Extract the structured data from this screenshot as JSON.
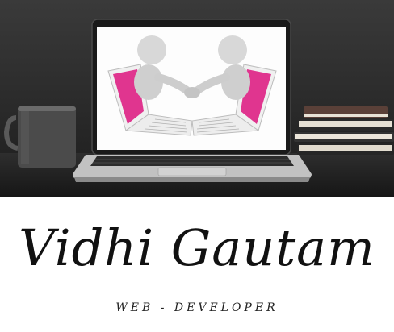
{
  "brand": {
    "name": "Vidhi Gautam",
    "tagline": "WEB - DEVELOPER"
  },
  "colors": {
    "accent": "#e0358f",
    "text": "#111111",
    "background": "#ffffff"
  },
  "icons": [
    "coffee-mug-icon",
    "laptop-icon",
    "handshake-icon",
    "books-icon"
  ]
}
